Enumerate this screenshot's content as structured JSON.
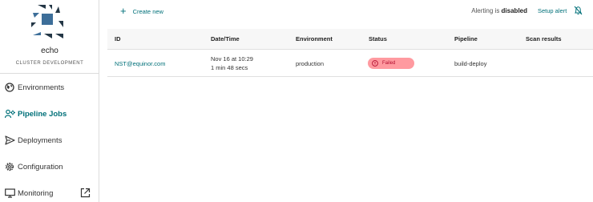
{
  "app": {
    "name": "echo",
    "environment": "CLUSTER DEVELOPMENT"
  },
  "sidebar": {
    "items": [
      {
        "label": "Environments",
        "icon": "globe-icon"
      },
      {
        "label": "Pipeline Jobs",
        "icon": "pipeline-jobs-icon",
        "active": true
      },
      {
        "label": "Deployments",
        "icon": "send-icon"
      },
      {
        "label": "Configuration",
        "icon": "gear-icon"
      },
      {
        "label": "Monitoring",
        "icon": "monitor-icon",
        "external": true
      }
    ]
  },
  "toolbar": {
    "create_label": "Create new",
    "alerting_prefix": "Alerting is",
    "alerting_state": "disabled",
    "setup_alert_label": "Setup alert"
  },
  "table": {
    "columns": [
      "ID",
      "Date/Time",
      "Environment",
      "Status",
      "Pipeline",
      "Scan results"
    ],
    "rows": [
      {
        "id": "NST@equinor.com",
        "date": "Nov 16 at 10:29",
        "duration": "1 min 48 secs",
        "environment": "production",
        "status": "Failed",
        "pipeline": "build-deploy",
        "scan_results": ""
      }
    ]
  },
  "colors": {
    "accent": "#007079",
    "failed_badge_bg": "#ff9aa0",
    "failed_text": "#b30d2f"
  }
}
